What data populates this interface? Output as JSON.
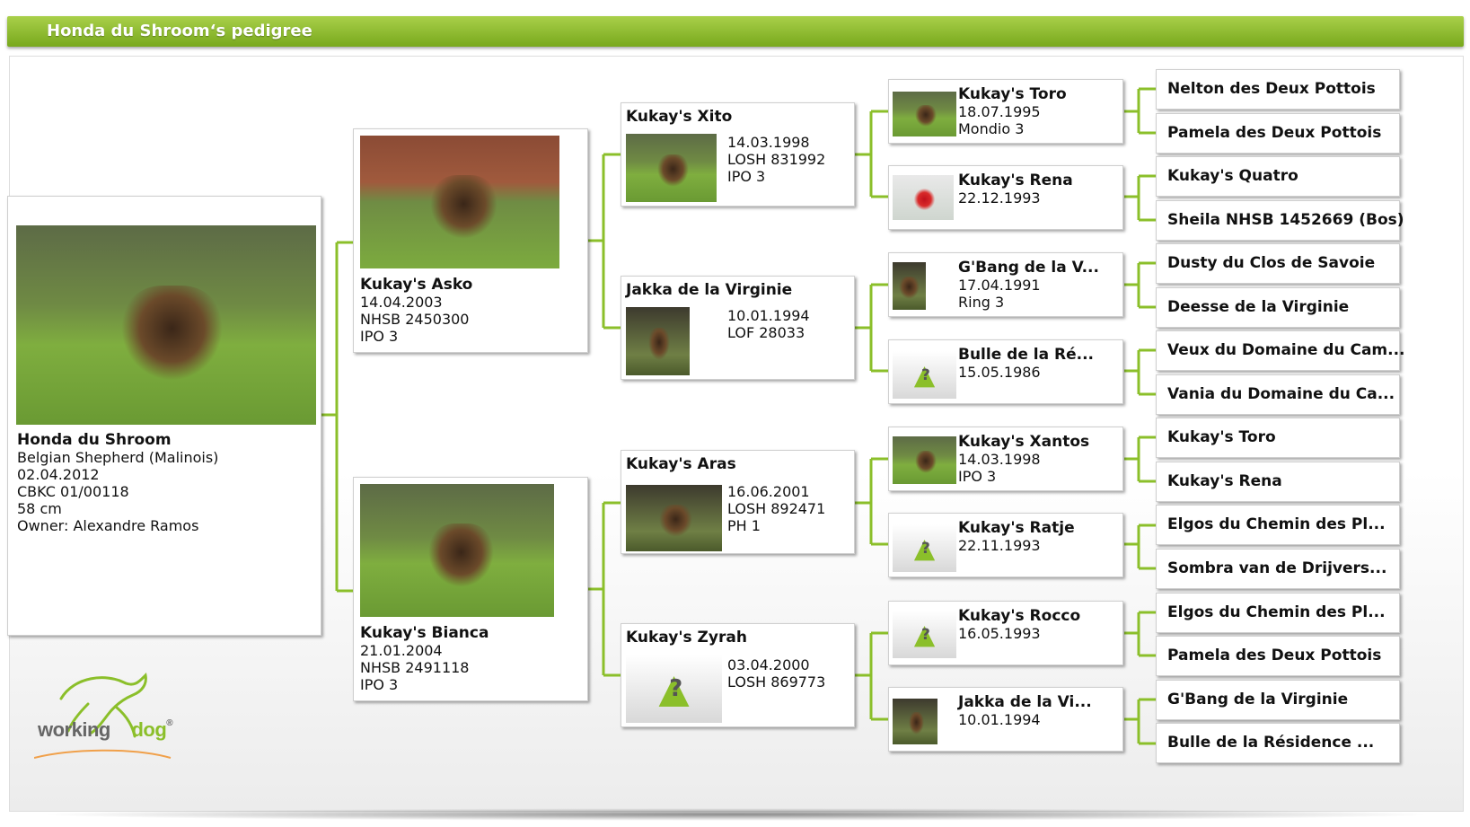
{
  "header": {
    "title": "Honda du Shroom‘s pedigree"
  },
  "colors": {
    "accent": "#8bbf2a",
    "connector": "#8bbf2a",
    "header": "#78a81c"
  },
  "subject": {
    "name": "Honda du Shroom",
    "breed": "Belgian Shepherd (Malinois)",
    "born": "02.04.2012",
    "registration": "CBKC 01/00118",
    "height": "58 cm",
    "owner": "Owner: Alexandre Ramos"
  },
  "parents": [
    {
      "name": "Kukay's Asko",
      "lines": [
        "14.04.2003",
        "NHSB 2450300",
        "IPO 3"
      ]
    },
    {
      "name": "Kukay's Bianca",
      "lines": [
        "21.01.2004",
        "NHSB 2491118",
        "IPO 3"
      ]
    }
  ],
  "grandparents": [
    {
      "name": "Kukay's Xito",
      "lines": [
        "14.03.1998",
        "LOSH 831992",
        "IPO 3"
      ],
      "photo": "photo"
    },
    {
      "name": "Jakka de la Virginie",
      "lines": [
        "10.01.1994",
        "LOF 28033"
      ],
      "photo": "photo"
    },
    {
      "name": "Kukay's Aras",
      "lines": [
        "16.06.2001",
        "LOSH 892471",
        "PH 1"
      ],
      "photo": "photo"
    },
    {
      "name": "Kukay's Zyrah",
      "lines": [
        "03.04.2000",
        "LOSH 869773"
      ],
      "photo": "unknown"
    }
  ],
  "great_grandparents": [
    {
      "name": "Kukay's Toro",
      "lines": [
        "18.07.1995",
        "Mondio 3"
      ],
      "photo": "photo"
    },
    {
      "name": "Kukay's Rena",
      "lines": [
        "22.12.1993"
      ],
      "photo": "photo-red"
    },
    {
      "name": "G'Bang de la V...",
      "lines": [
        "17.04.1991",
        "Ring 3"
      ],
      "photo": "photo"
    },
    {
      "name": "Bulle de la Ré...",
      "lines": [
        "15.05.1986"
      ],
      "photo": "unknown"
    },
    {
      "name": "Kukay's Xantos",
      "lines": [
        "14.03.1998",
        "IPO 3"
      ],
      "photo": "photo"
    },
    {
      "name": "Kukay's Ratje",
      "lines": [
        "22.11.1993"
      ],
      "photo": "unknown"
    },
    {
      "name": "Kukay's Rocco",
      "lines": [
        "16.05.1993"
      ],
      "photo": "unknown"
    },
    {
      "name": "Jakka de la Vi...",
      "lines": [
        "10.01.1994"
      ],
      "photo": "photo"
    }
  ],
  "gen4": [
    "Nelton des Deux Pottois",
    "Pamela des Deux Pottois",
    "Kukay's Quatro",
    "Sheila  NHSB 1452669 (Bos)",
    "Dusty du Clos de Savoie",
    "Deesse de la Virginie",
    "Veux du Domaine du Cam...",
    "Vania du Domaine du Ca...",
    "Kukay's Toro",
    "Kukay's Rena",
    "Elgos du Chemin des Pl...",
    "Sombra van de Drijvers...",
    "Elgos du Chemin des Pl...",
    "Pamela des Deux Pottois",
    "G'Bang de la Virginie",
    "Bulle de la Résidence ..."
  ],
  "logo": {
    "word1": "working",
    "word2": "dog",
    "mark": "®"
  },
  "unknown_glyph": "?"
}
